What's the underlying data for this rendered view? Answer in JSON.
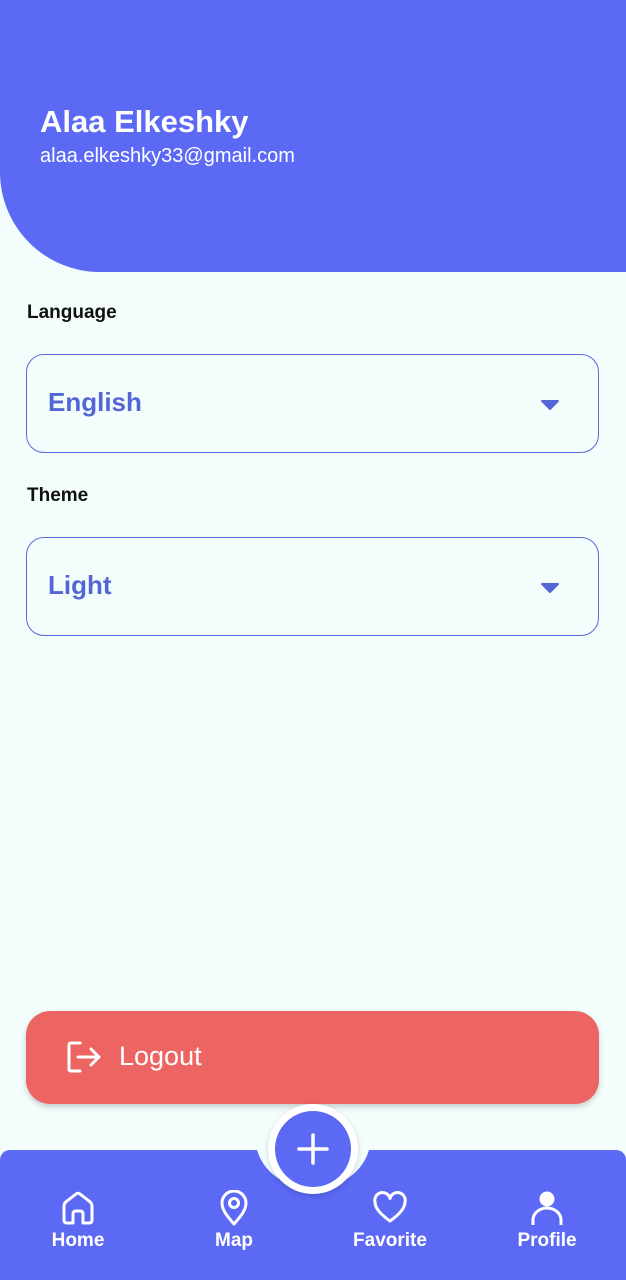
{
  "header": {
    "user_name": "Alaa Elkeshky",
    "user_email": "alaa.elkeshky33@gmail.com"
  },
  "settings": {
    "language_label": "Language",
    "language_value": "English",
    "theme_label": "Theme",
    "theme_value": "Light"
  },
  "logout": {
    "label": "Logout",
    "icon": "logout-icon"
  },
  "bottom_nav": {
    "items": [
      {
        "label": "Home",
        "icon": "home-icon"
      },
      {
        "label": "Map",
        "icon": "map-pin-icon"
      },
      {
        "label": "Favorite",
        "icon": "heart-icon"
      },
      {
        "label": "Profile",
        "icon": "profile-icon"
      }
    ],
    "fab_icon": "plus-icon"
  },
  "colors": {
    "primary": "#5b69f5",
    "background": "#f2fdfc",
    "danger": "#ec6562",
    "accent_text": "#5466d6"
  }
}
